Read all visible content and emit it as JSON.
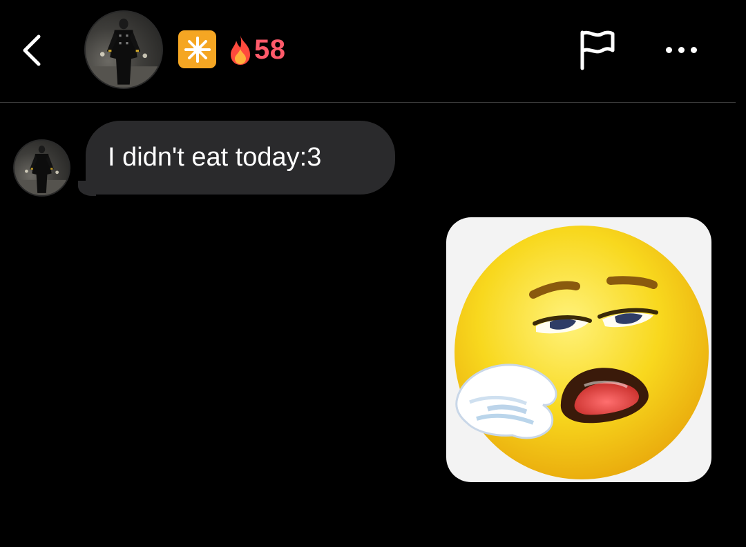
{
  "header": {
    "back_icon": "chevron-left-icon",
    "badge_icon": "sparkle-icon",
    "streak_icon": "fire-icon",
    "streak_count": "58",
    "flag_icon": "flag-icon",
    "more_icon": "ellipsis-icon"
  },
  "colors": {
    "background": "#000000",
    "bubble": "#2a2a2c",
    "streak": "#ff5a6a",
    "badge": "#f5a623",
    "divider": "#3a3a3a"
  },
  "messages": [
    {
      "sender": "other",
      "type": "text",
      "text": "I didn't eat today:3"
    },
    {
      "sender": "self",
      "type": "sticker",
      "sticker": "yawning-tired-face-emoji"
    }
  ]
}
